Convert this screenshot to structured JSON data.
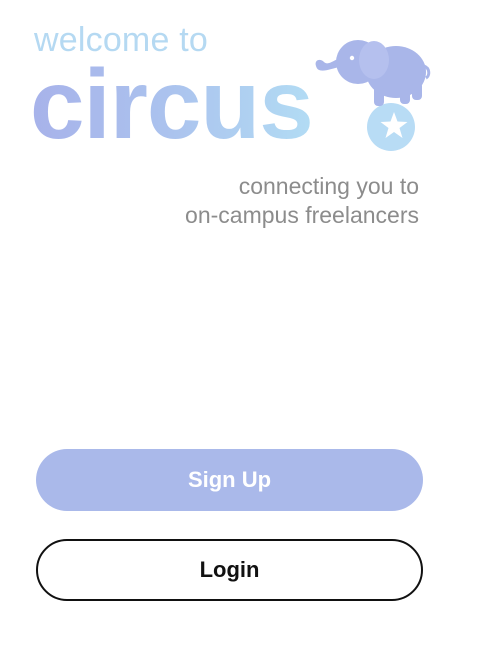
{
  "header": {
    "welcome": "welcome to",
    "brand": "circus",
    "mascot_icon": "elephant-on-ball-icon"
  },
  "tagline": {
    "line1": "connecting you to",
    "line2": "on-campus freelancers"
  },
  "actions": {
    "signup_label": "Sign Up",
    "login_label": "Login"
  },
  "colors": {
    "brand_lavender": "#aab9ea",
    "brand_sky": "#b5d9f2",
    "muted_text": "#8c8c8c"
  }
}
